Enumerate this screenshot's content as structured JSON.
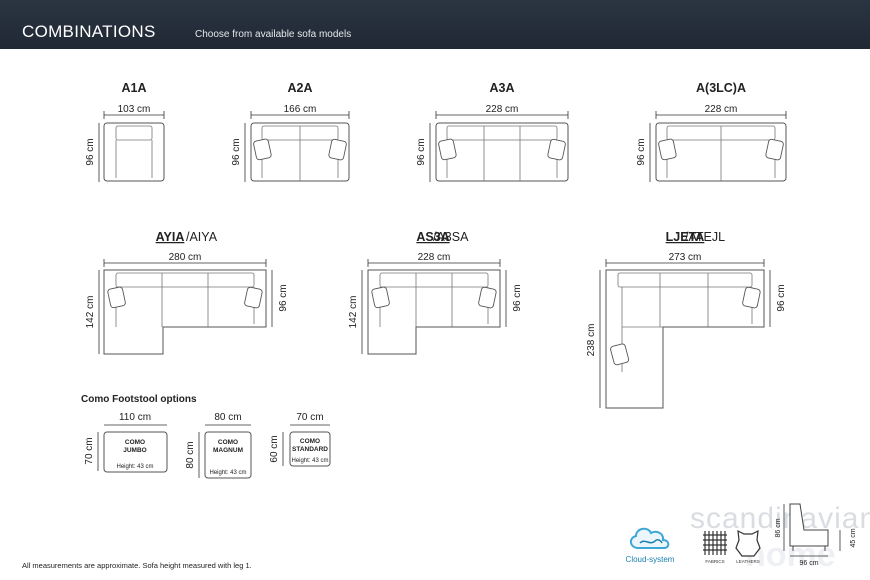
{
  "header": {
    "title": "COMBINATIONS",
    "subtitle": "Choose from available sofa models"
  },
  "sofas": [
    {
      "name": "A1A",
      "width_label": "103 cm",
      "height_label": "96 cm"
    },
    {
      "name": "A2A",
      "width_label": "166 cm",
      "height_label": "96 cm"
    },
    {
      "name": "A3A",
      "width_label": "228 cm",
      "height_label": "96 cm"
    },
    {
      "name": "A(3LC)A",
      "width_label": "228 cm",
      "height_label": "96 cm"
    }
  ],
  "corner_sofas": [
    {
      "name_bold": "AYIA",
      "name_alt": "/AIYA",
      "width_label": "280 cm",
      "depth_label": "142 cm",
      "height_label": "96 cm"
    },
    {
      "name_bold": "AS3A",
      "name_alt": "/A3SA",
      "width_label": "228 cm",
      "depth_label": "142 cm",
      "height_label": "96 cm"
    },
    {
      "name_bold": "LJETA",
      "name_alt": "/ATEJL",
      "width_label": "273 cm",
      "depth_label": "238 cm",
      "height_label": "96 cm"
    }
  ],
  "footstools": {
    "heading": "Como Footstool options",
    "items": [
      {
        "width_label": "110 cm",
        "depth_label": "70 cm",
        "line1": "COMO",
        "line2": "JUMBO",
        "height_note": "Height: 43 cm"
      },
      {
        "width_label": "80 cm",
        "depth_label": "80 cm",
        "line1": "COMO",
        "line2": "MAGNUM",
        "height_note": "Height: 43 cm"
      },
      {
        "width_label": "70 cm",
        "depth_label": "60 cm",
        "line1": "COMO",
        "line2": "STANDARD",
        "height_note": "Height: 43 cm"
      }
    ]
  },
  "footnote": "All measurements are approximate. Sofa height measured with leg 1.",
  "brand": {
    "cloud_label": "Cloud-system",
    "fabrics_label": "FABRICS",
    "leathers_label": "LEATHERS",
    "watermark": "scandinavian",
    "side_height": "86 cm",
    "side_seat": "45 cm",
    "side_depth": "96 cm"
  },
  "colors": {
    "header_bg": "#252e3a",
    "line": "#555555",
    "text": "#222222"
  }
}
